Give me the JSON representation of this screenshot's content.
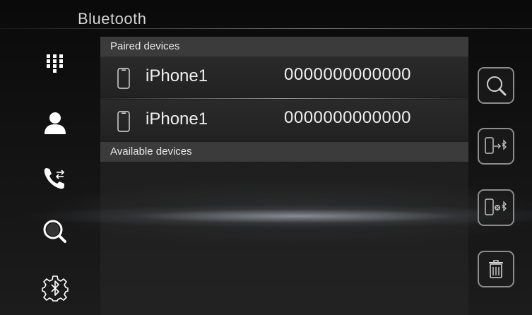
{
  "header": {
    "title": "Bluetooth"
  },
  "nav": {
    "items": [
      {
        "icon": "keypad-icon"
      },
      {
        "icon": "contacts-icon"
      },
      {
        "icon": "call-history-icon"
      },
      {
        "icon": "search-icon",
        "active": true
      },
      {
        "icon": "bluetooth-settings-icon"
      }
    ]
  },
  "paired": {
    "header": "Paired devices",
    "devices": [
      {
        "name": "iPhone1",
        "address": "0000000000000"
      },
      {
        "name": "iPhone1",
        "address": "0000000000000"
      }
    ]
  },
  "available": {
    "header": "Available devices"
  },
  "actions": [
    {
      "icon": "search-devices-icon"
    },
    {
      "icon": "connect-device-icon"
    },
    {
      "icon": "disconnect-device-icon"
    },
    {
      "icon": "delete-icon"
    }
  ],
  "colors": {
    "accent": "#e6e6e6",
    "panel": "#3b3b3b",
    "background": "#111111"
  }
}
